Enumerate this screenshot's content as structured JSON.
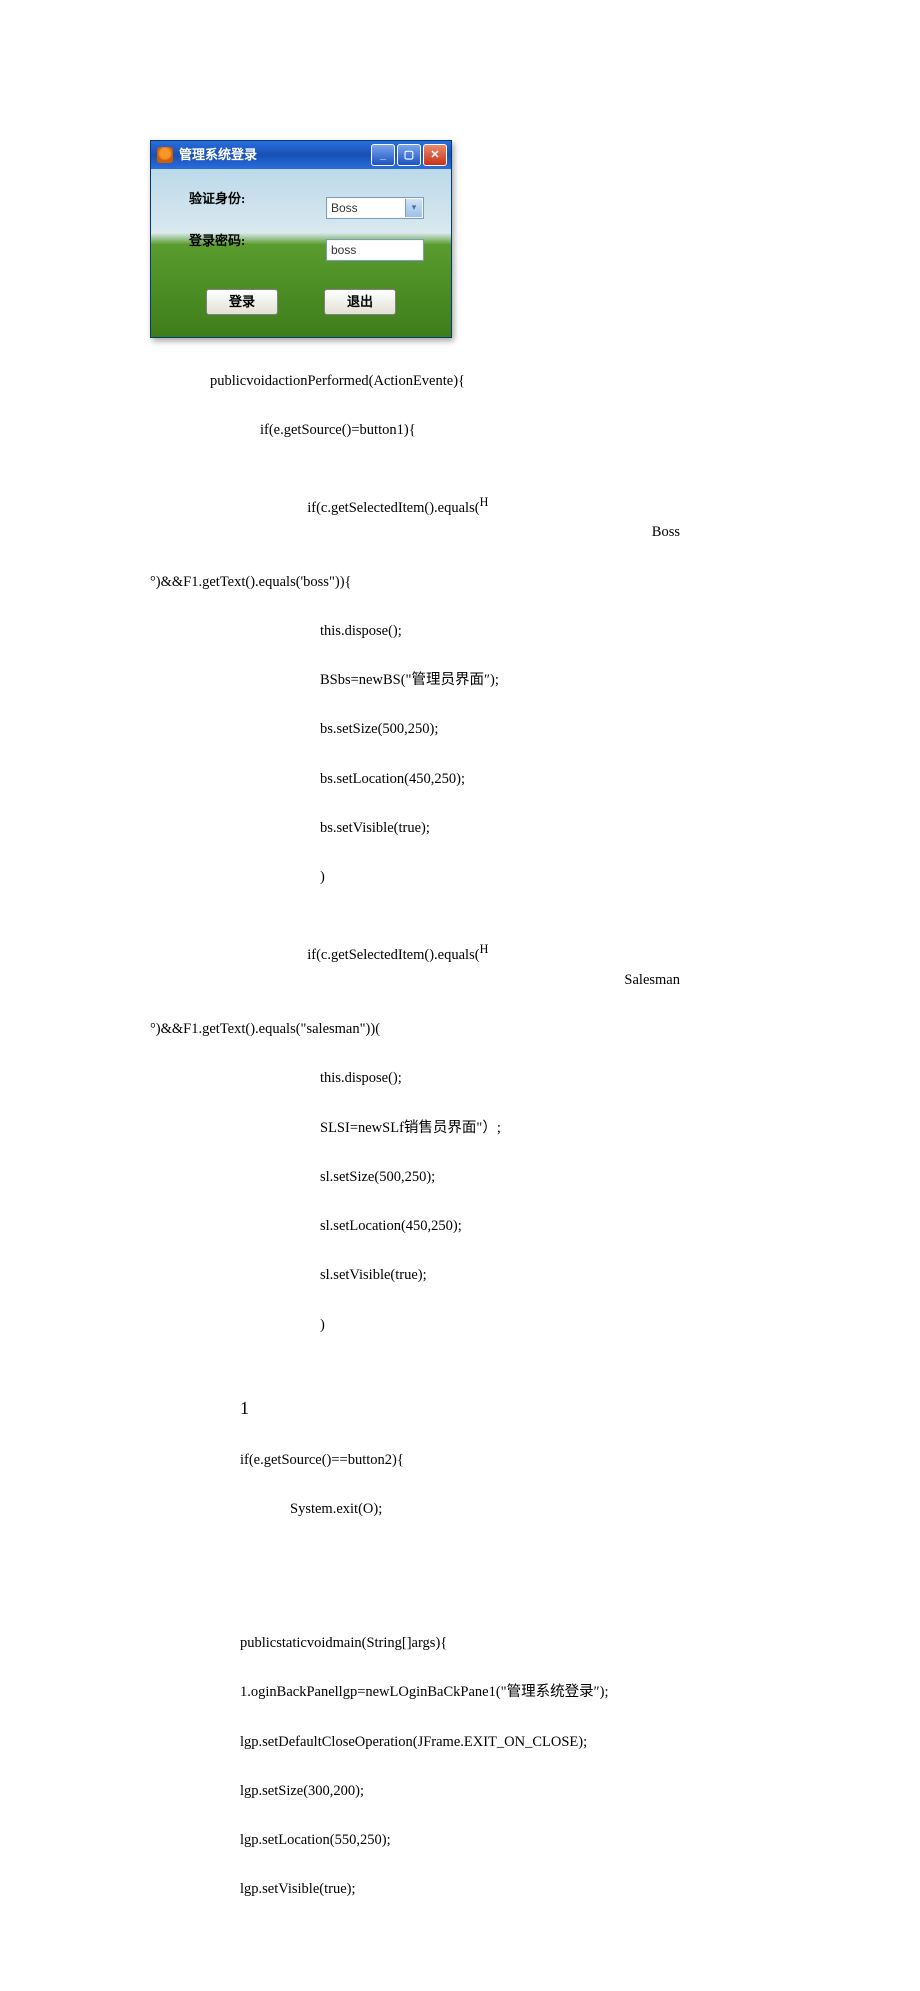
{
  "window": {
    "title": "管理系统登录",
    "identity_label": "验证身份:",
    "identity_value": "Boss",
    "password_label": "登录密码:",
    "password_value": "boss",
    "login_btn": "登录",
    "exit_btn": "退出"
  },
  "code": {
    "l01": "publicvoidactionPerformed(ActionEvente){",
    "l02": "if(e.getSource()=button1){",
    "l03a": "if(c.getSelectedItem().equals(",
    "l03sup": "H",
    "l03b_right": "Boss",
    "l04": "°)&&F1.getText().equals('boss\")){",
    "l05": "this.dispose();",
    "l06": "BSbs=newBS(\"管理员界面″);",
    "l07": "bs.setSize(500,250);",
    "l08": "bs.setLocation(450,250);",
    "l09": "bs.setVisible(true);",
    "l10": ")",
    "l11a": "if(c.getSelectedItem().equals(",
    "l11sup": "H",
    "l11b_right": "Salesman",
    "l12": "°)&&F1.getText().equals(\"salesman\"))(",
    "l13": "this.dispose();",
    "l14": "SLSI=newSLf销售员界面\"）;",
    "l15": "sl.setSize(500,250);",
    "l16": "sl.setLocation(450,250);",
    "l17": "sl.setVisible(true);",
    "l18": ")",
    "l19": "1",
    "l20": "if(e.getSource()==button2){",
    "l21": "System.exit(O);",
    "m01": "publicstaticvoidmain(String[]args){",
    "m02": "1.oginBackPanellgp=newLOginBaCkPane1(\"管理系统登录″);",
    "m03": "lgp.setDefaultCloseOperation(JFrame.EXIT_ON_CLOSE);",
    "m04": "lgp.setSize(300,200);",
    "m05": "lgp.setLocation(550,250);",
    "m06": "lgp.setVisible(true);"
  }
}
